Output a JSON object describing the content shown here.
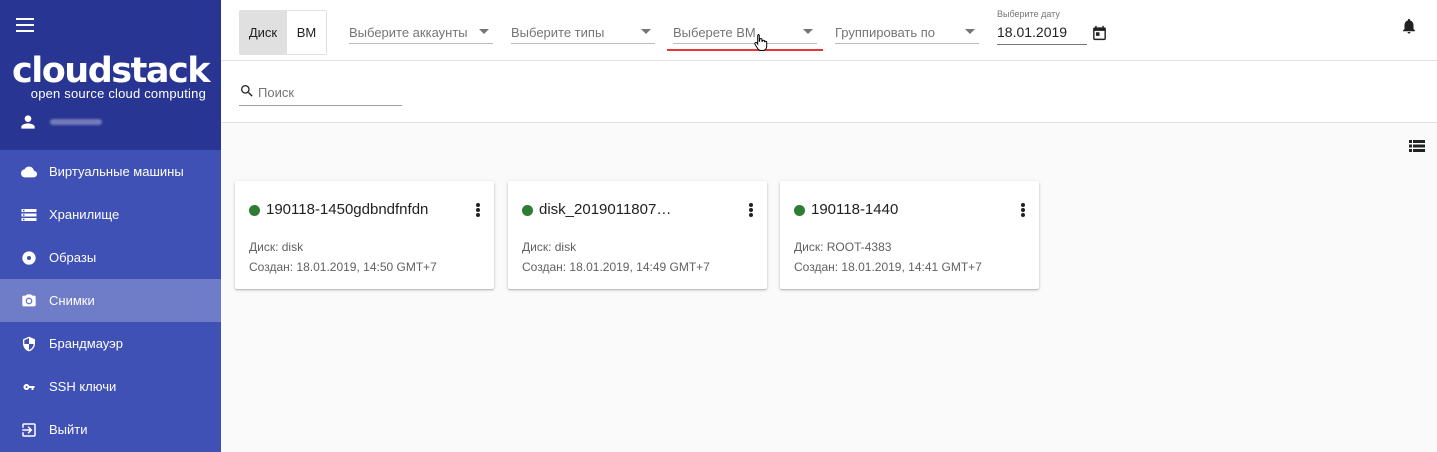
{
  "sidebar": {
    "logo_main": "cloudstack",
    "logo_sub": "open source cloud computing",
    "items": [
      {
        "label": "Виртуальные машины",
        "icon": "cloud-icon"
      },
      {
        "label": "Хранилище",
        "icon": "storage-icon"
      },
      {
        "label": "Образы",
        "icon": "disc-icon"
      },
      {
        "label": "Снимки",
        "icon": "camera-icon",
        "active": true
      },
      {
        "label": "Брандмауэр",
        "icon": "shield-icon"
      },
      {
        "label": "SSH ключи",
        "icon": "key-icon"
      },
      {
        "label": "Выйти",
        "icon": "logout-icon"
      }
    ]
  },
  "toolbar": {
    "toggle_disk": "Диск",
    "toggle_vm": "ВМ",
    "select_accounts": "Выберите аккаунты",
    "select_types": "Выберите типы",
    "select_vm": "Выберете ВМ",
    "group_by": "Группировать по",
    "date_caption": "Выберите дату",
    "date_value": "18.01.2019"
  },
  "search": {
    "placeholder": "Поиск"
  },
  "cards": [
    {
      "title": "190118-1450gdbndfnfdn",
      "line1": "Диск: disk",
      "line2": "Создан: 18.01.2019, 14:50 GMT+7",
      "status_color": "#2e7d32"
    },
    {
      "title": "disk_2019011807…",
      "line1": "Диск: disk",
      "line2": "Создан: 18.01.2019, 14:49 GMT+7",
      "status_color": "#2e7d32"
    },
    {
      "title": "190118-1440",
      "line1": "Диск: ROOT-4383",
      "line2": "Создан: 18.01.2019, 14:41 GMT+7",
      "status_color": "#2e7d32"
    }
  ],
  "colors": {
    "sidebar": "#3f51b5",
    "sidebar_header": "#283593",
    "focus_underline": "#e53935",
    "status_ok": "#2e7d32"
  }
}
